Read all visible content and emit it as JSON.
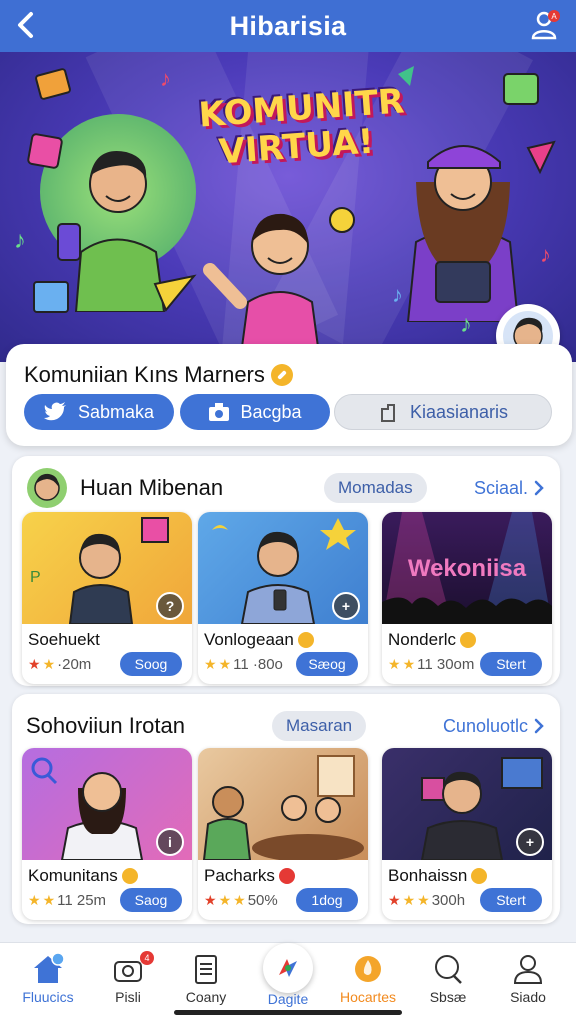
{
  "header": {
    "title": "Hibarisia"
  },
  "hero": {
    "title": "KOMUNITR VIRTUA!"
  },
  "community": {
    "title": "Komuniian Kıns Marners",
    "buttons": [
      {
        "label": "Sabmaka",
        "icon": "bird-icon"
      },
      {
        "label": "Bacgba",
        "icon": "camera-icon"
      },
      {
        "label": "Kiaasianaris",
        "icon": "wrench-icon"
      }
    ]
  },
  "section1": {
    "title": "Huan Mibenan",
    "chip": "Momadas",
    "link": "Sciaal.",
    "tiles": [
      {
        "name": "Soehuekt",
        "rating": "·20m",
        "button": "Soog"
      },
      {
        "name": "Vonlogeaan",
        "rating": "11 ·80o",
        "button": "Sæog"
      },
      {
        "name": "Nonderlc",
        "rating": "11 30om",
        "button": "Stert"
      }
    ]
  },
  "section2": {
    "title": "Sohoviiun Irotan",
    "chip": "Masaran",
    "link": "Cunoluotlc",
    "tiles": [
      {
        "name": "Komunitans",
        "rating": "11 25m",
        "button": "Saog"
      },
      {
        "name": "Pacharks",
        "rating": "50%",
        "button": "1dog"
      },
      {
        "name": "Bonhaissn",
        "rating": "300h",
        "button": "Stert"
      }
    ]
  },
  "hero_banner_sign": "Wekoniisa",
  "bottom_nav": [
    {
      "label": "Fluucics",
      "icon": "home-icon",
      "badge": ""
    },
    {
      "label": "Pisli",
      "icon": "camera-icon",
      "badge": "4"
    },
    {
      "label": "Coany",
      "icon": "clipboard-icon",
      "badge": ""
    },
    {
      "label": "Dagite",
      "icon": "compass-icon",
      "badge": ""
    },
    {
      "label": "Hocartes",
      "icon": "flame-icon",
      "badge": ""
    },
    {
      "label": "Sbsæ",
      "icon": "chat-icon",
      "badge": ""
    },
    {
      "label": "Siado",
      "icon": "person-icon",
      "badge": ""
    }
  ],
  "colors": {
    "primary": "#3f6fd3",
    "accent": "#f4b52a",
    "orange": "#f28a1e"
  }
}
